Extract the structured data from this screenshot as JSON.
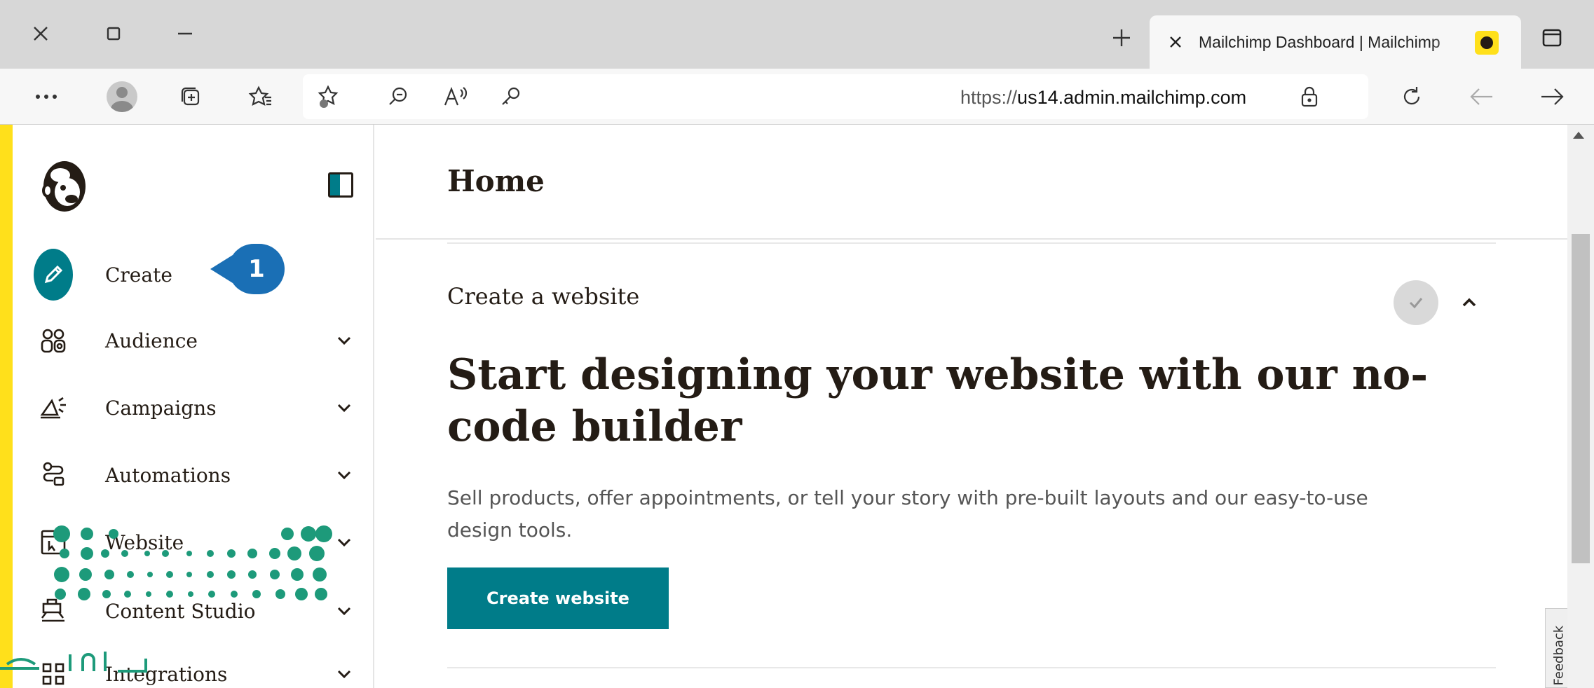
{
  "browser": {
    "tab_title": "Mailchimp Dashboard | Mailchimp",
    "url_prefix": "https://",
    "url_host": "us14.admin.mailchimp.com"
  },
  "sidebar": {
    "items": [
      {
        "label": "Create",
        "icon": "pencil-icon"
      },
      {
        "label": "Audience",
        "icon": "audience-icon"
      },
      {
        "label": "Campaigns",
        "icon": "megaphone-icon"
      },
      {
        "label": "Automations",
        "icon": "automation-icon"
      },
      {
        "label": "Website",
        "icon": "website-icon"
      },
      {
        "label": "Content Studio",
        "icon": "content-studio-icon"
      },
      {
        "label": "Integrations",
        "icon": "integrations-icon"
      }
    ],
    "callout_number": "1"
  },
  "main": {
    "page_title": "Home",
    "card_label": "Create a website",
    "headline": "Start designing your website with our no-code builder",
    "description": "Sell products, offer appointments, or tell your story with pre-built layouts and our easy-to-use design tools.",
    "cta_label": "Create website"
  },
  "feedback_label": "Feedback",
  "colors": {
    "brand_yellow": "#ffe01b",
    "brand_teal": "#007c89",
    "callout_blue": "#1a6fb5",
    "watermark_green": "#1d9a7a"
  }
}
